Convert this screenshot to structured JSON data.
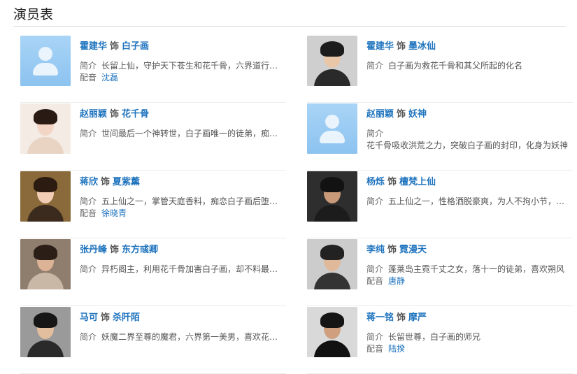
{
  "section_title": "演员表",
  "labels": {
    "shi": "饰",
    "intro": "简介",
    "dub": "配音"
  },
  "cast": [
    {
      "actor": "霍建华",
      "role": "白子画",
      "intro": "长留上仙，守护天下苍生和花千骨，六界道行…",
      "dub": "沈磊",
      "photo": "default"
    },
    {
      "actor": "霍建华",
      "role": "墨冰仙",
      "intro": "白子画为救花千骨和其父所起的化名",
      "dub": "",
      "photo": "person"
    },
    {
      "actor": "赵丽颖",
      "role": "花千骨",
      "intro": "世间最后一个神转世，白子画唯一的徒弟，痴…",
      "dub": "",
      "photo": "person"
    },
    {
      "actor": "赵丽颖",
      "role": "妖神",
      "intro": "",
      "intro2": "花千骨吸收洪荒之力，突破白子画的封印，化身为妖神",
      "dub": "",
      "photo": "default"
    },
    {
      "actor": "蒋欣",
      "role": "夏紫薰",
      "intro": "五上仙之一，掌管天庭香料，痴恋白子画后堕…",
      "dub": "徐晓青",
      "photo": "person"
    },
    {
      "actor": "杨烁",
      "role": "檀梵上仙",
      "intro": "五上仙之一，性格洒脱豪爽，为人不拘小节，…",
      "dub": "",
      "photo": "person"
    },
    {
      "actor": "张丹峰",
      "role": "东方彧卿",
      "intro": "异朽阁主，利用花千骨加害白子画，却不料最…",
      "dub": "",
      "photo": "person"
    },
    {
      "actor": "李纯",
      "role": "霓漫天",
      "intro": "蓬莱岛主霓千丈之女，落十一的徒弟，喜欢朔风",
      "dub": "唐静",
      "photo": "person"
    },
    {
      "actor": "马可",
      "role": "杀阡陌",
      "intro": "妖魔二界至尊的魔君，六界第一美男，喜欢花…",
      "dub": "",
      "photo": "person"
    },
    {
      "actor": "蒋一铭",
      "role": "摩严",
      "intro": "长留世尊，白子画的师兄",
      "dub": "陆揆",
      "photo": "person"
    }
  ],
  "colors": {
    "link": "#1e73be",
    "rule": "#d8d8d8",
    "avatar_bg": "#a9d4f6"
  }
}
